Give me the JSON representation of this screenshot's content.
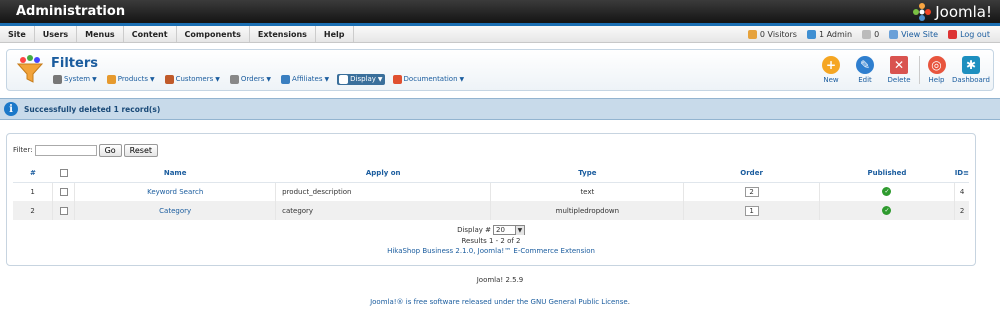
{
  "header": {
    "title": "Administration",
    "logo_text": "Joomla!"
  },
  "menu": {
    "items": [
      "Site",
      "Users",
      "Menus",
      "Content",
      "Components",
      "Extensions",
      "Help"
    ],
    "status": {
      "visitors": "0 Visitors",
      "admins": "1 Admin",
      "messages": "0",
      "view_site": "View Site",
      "logout": "Log out"
    }
  },
  "toolbar": {
    "title": "Filters",
    "submenu": [
      {
        "label": "System",
        "icon": "wrench-icon",
        "active": false
      },
      {
        "label": "Products",
        "icon": "box-icon",
        "active": false
      },
      {
        "label": "Customers",
        "icon": "users-icon",
        "active": false
      },
      {
        "label": "Orders",
        "icon": "cart-icon",
        "active": false
      },
      {
        "label": "Affiliates",
        "icon": "affiliate-icon",
        "active": false
      },
      {
        "label": "Display",
        "icon": "display-icon",
        "active": true
      },
      {
        "label": "Documentation",
        "icon": "lifebuoy-icon",
        "active": false
      }
    ],
    "buttons": {
      "new": "New",
      "edit": "Edit",
      "delete": "Delete",
      "help": "Help",
      "dashboard": "Dashboard"
    }
  },
  "message": {
    "text": "Successfully deleted 1 record(s)"
  },
  "filter": {
    "label": "Filter:",
    "value": "",
    "go": "Go",
    "reset": "Reset"
  },
  "table": {
    "headers": {
      "num": "#",
      "name": "Name",
      "apply_on": "Apply on",
      "type": "Type",
      "order": "Order",
      "published": "Published",
      "id": "ID"
    },
    "rows": [
      {
        "num": "1",
        "name": "Keyword Search",
        "apply_on": "product_description",
        "type": "text",
        "order": "2",
        "published": true,
        "id": "4"
      },
      {
        "num": "2",
        "name": "Category",
        "apply_on": "category",
        "type": "multipledropdown",
        "order": "1",
        "published": true,
        "id": "2"
      }
    ]
  },
  "pagination": {
    "display_label": "Display #",
    "display_value": "20",
    "results": "Results 1 - 2 of 2",
    "credit": "HikaShop Business 2.1.0, Joomla!™ E-Commerce Extension"
  },
  "footer": {
    "version": "Joomla! 2.5.9",
    "license_prefix": "Joomla!® is free software released under the ",
    "license_link": "GNU General Public License",
    "license_suffix": "."
  },
  "colors": {
    "link": "#1a5c9e",
    "message_bg": "#c8daea",
    "accent": "#1b6fb3"
  }
}
